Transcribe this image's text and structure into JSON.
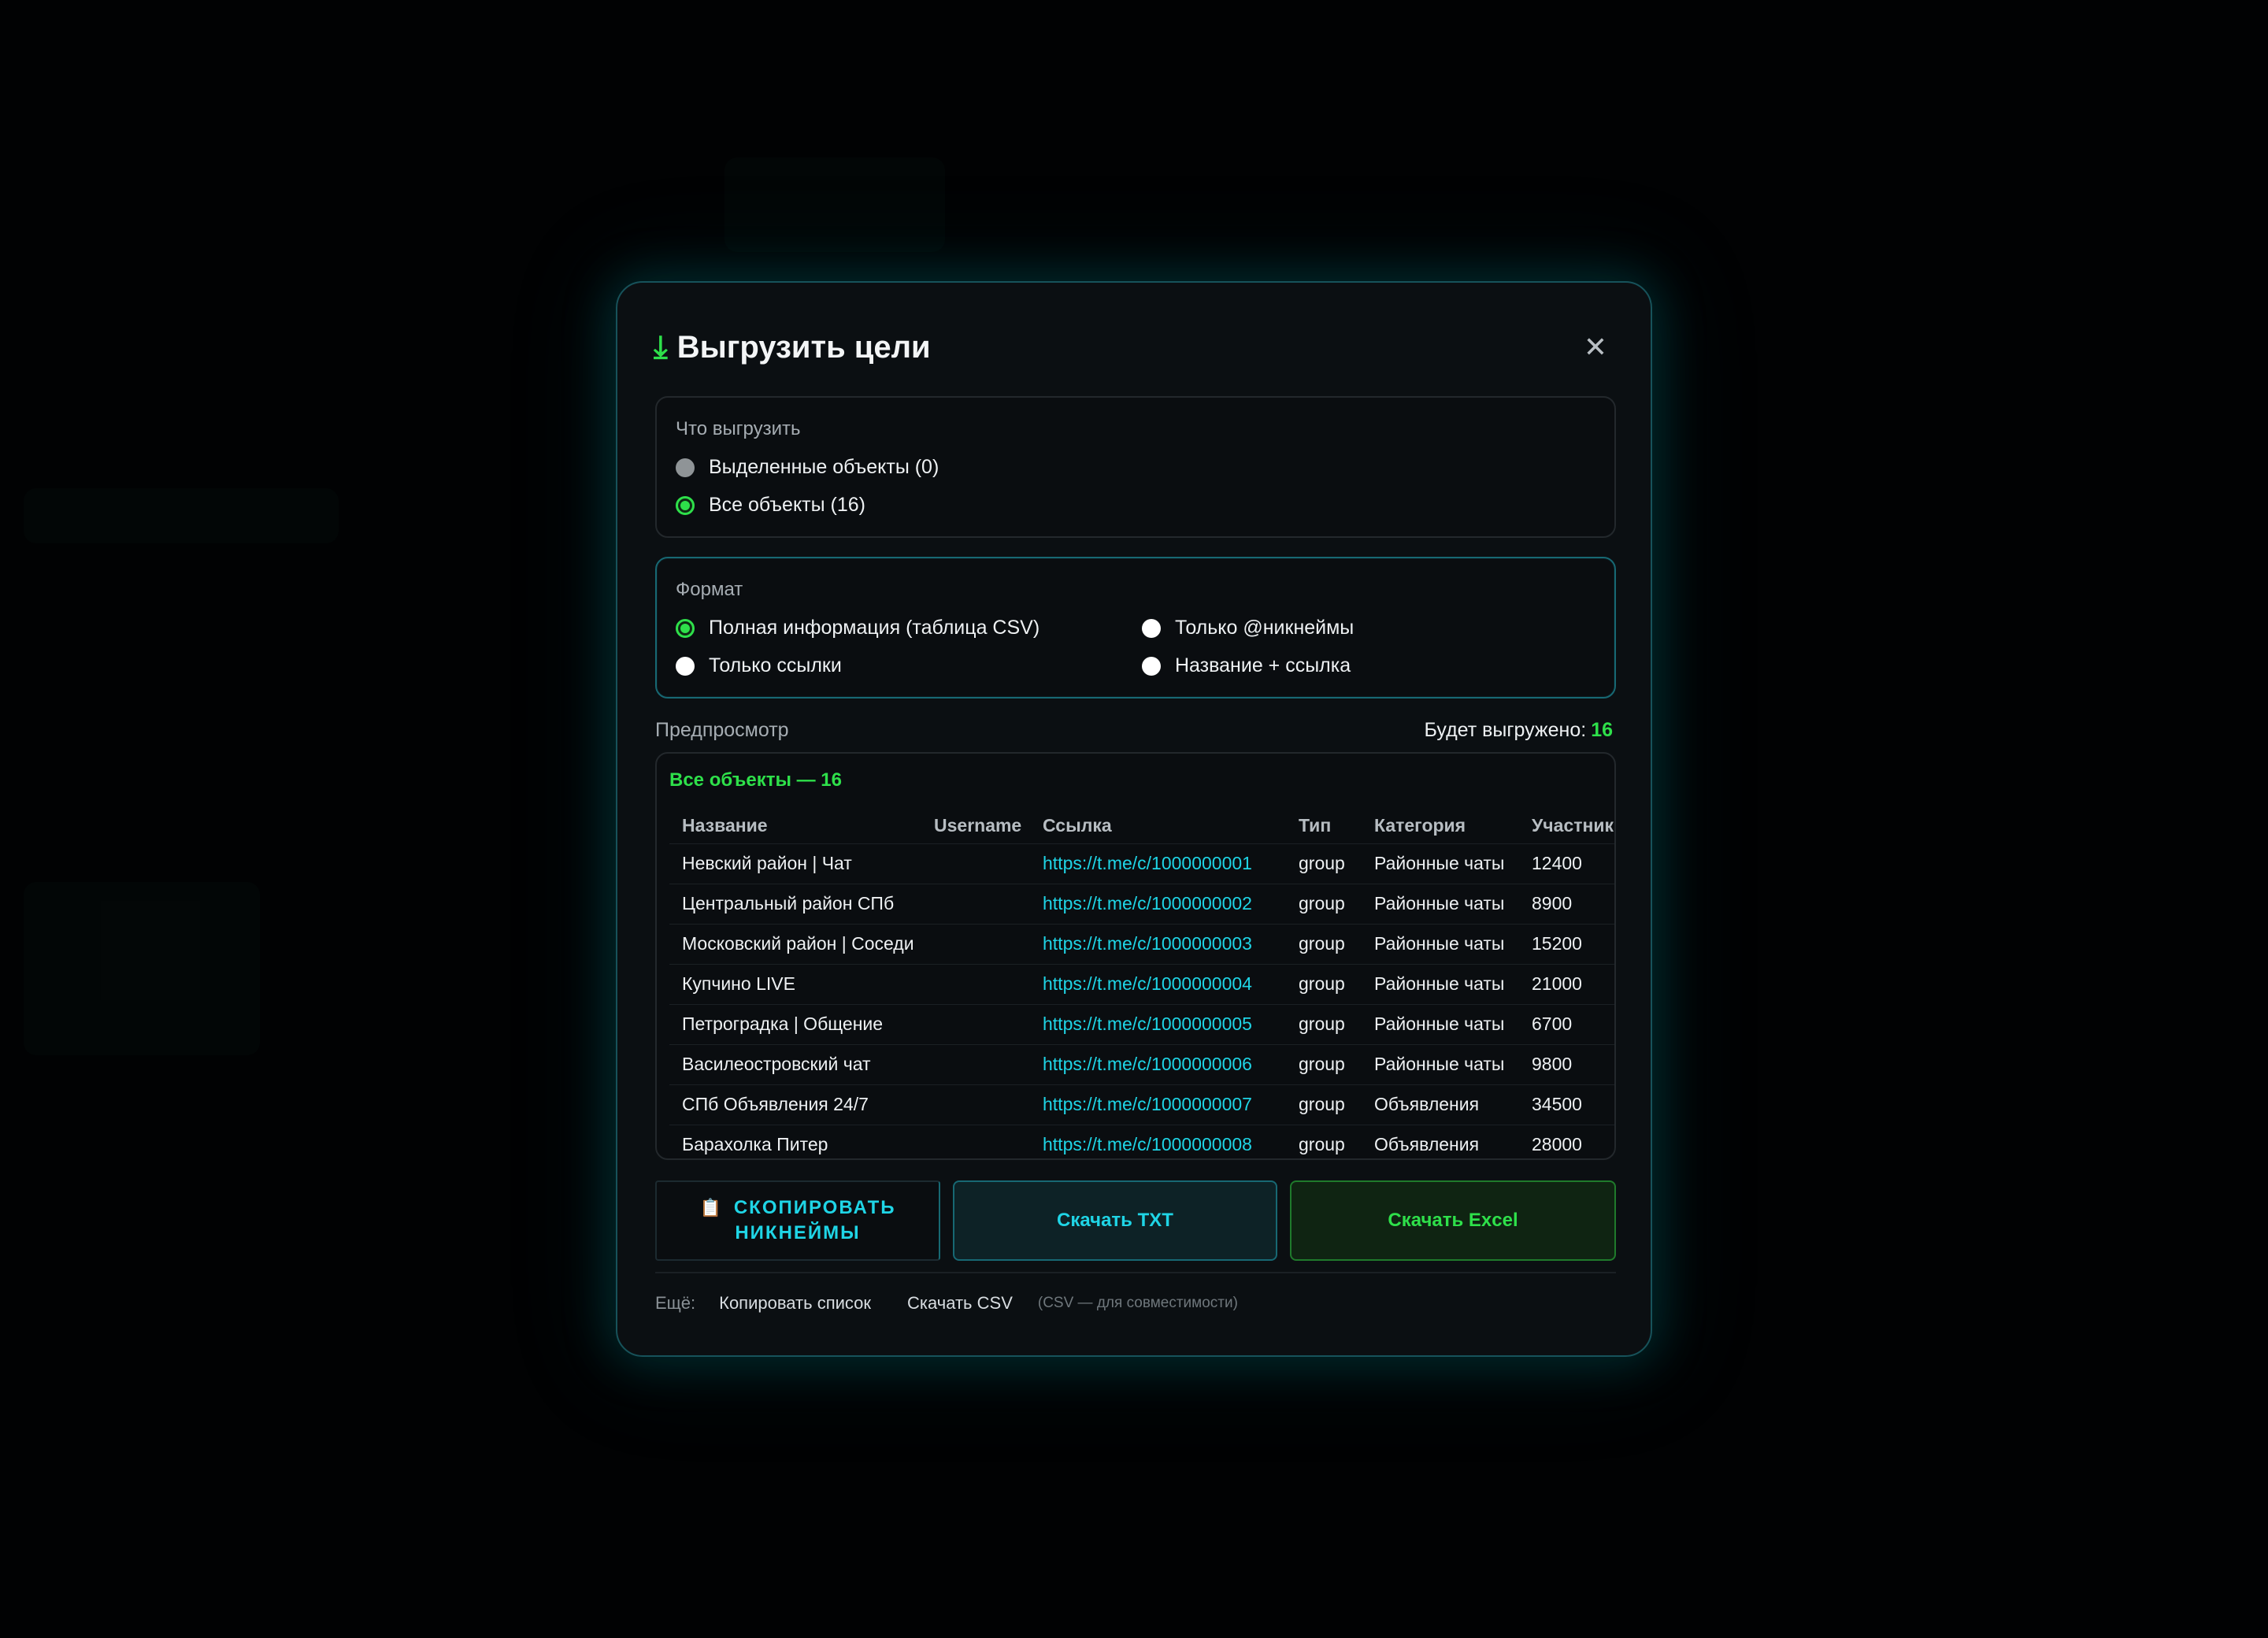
{
  "modal": {
    "title_icon": "⤓",
    "title": "Выгрузить цели",
    "close_icon": "✕"
  },
  "what": {
    "label": "Что выгрузить",
    "options": [
      {
        "label": "Выделенные объекты (0)",
        "selected": false
      },
      {
        "label": "Все объекты (16)",
        "selected": true
      }
    ]
  },
  "format": {
    "label": "Формат",
    "options": [
      {
        "label": "Полная информация (таблица CSV)",
        "selected": true
      },
      {
        "label": "Только @никнеймы",
        "selected": false
      },
      {
        "label": "Только ссылки",
        "selected": false
      },
      {
        "label": "Название + ссылка",
        "selected": false
      }
    ]
  },
  "preview": {
    "label": "Предпросмотр",
    "will_export_label": "Будет выгружено:",
    "will_export_count": "16",
    "title": "Все объекты — 16",
    "columns": [
      "Название",
      "Username",
      "Ссылка",
      "Тип",
      "Категория",
      "Участники"
    ],
    "rows": [
      [
        "Невский район | Чат",
        "",
        "https://t.me/c/1000000001",
        "group",
        "Районные чаты",
        "12400"
      ],
      [
        "Центральный район СПб",
        "",
        "https://t.me/c/1000000002",
        "group",
        "Районные чаты",
        "8900"
      ],
      [
        "Московский район | Соседи",
        "",
        "https://t.me/c/1000000003",
        "group",
        "Районные чаты",
        "15200"
      ],
      [
        "Купчино LIVE",
        "",
        "https://t.me/c/1000000004",
        "group",
        "Районные чаты",
        "21000"
      ],
      [
        "Петроградка | Общение",
        "",
        "https://t.me/c/1000000005",
        "group",
        "Районные чаты",
        "6700"
      ],
      [
        "Василеостровский чат",
        "",
        "https://t.me/c/1000000006",
        "group",
        "Районные чаты",
        "9800"
      ],
      [
        "СПб Объявления 24/7",
        "",
        "https://t.me/c/1000000007",
        "group",
        "Объявления",
        "34500"
      ],
      [
        "Барахолка Питер",
        "",
        "https://t.me/c/1000000008",
        "group",
        "Объявления",
        "28000"
      ]
    ]
  },
  "actions": {
    "copy_icon": "📋",
    "copy_line1": "СКОПИРОВАТЬ",
    "copy_line2": "НИКНЕЙМЫ",
    "download_txt": "Скачать TXT",
    "download_excel": "Скачать Excel"
  },
  "more": {
    "label": "Ещё:",
    "copy_list": "Копировать список",
    "download_csv": "Скачать CSV",
    "note": "(CSV — для совместимости)"
  },
  "colors": {
    "accent_green": "#2ee04a",
    "accent_cyan": "#1fd5e6",
    "modal_border": "#17525a"
  }
}
